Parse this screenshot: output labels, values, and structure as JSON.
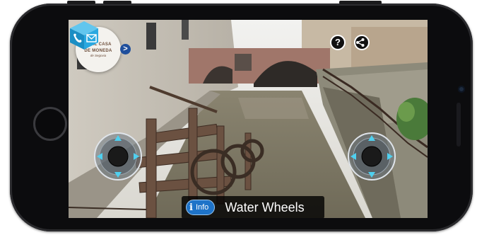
{
  "app": {
    "logo": {
      "line1": "REAL CASA",
      "line2": "DE MONEDA",
      "line3": "de Segovia"
    },
    "nav_chevron": ">",
    "top_buttons": {
      "help": "?",
      "share_icon": "share-icon",
      "cube_icon": "phone-envelope-cube-icon"
    },
    "joysticks": {
      "left": {
        "name": "left-joystick"
      },
      "right": {
        "name": "right-joystick"
      }
    },
    "caption": {
      "info_icon": "i",
      "info_label": "Info",
      "title": "Water Wheels"
    }
  },
  "colors": {
    "accent_blue": "#1e73c8",
    "cube_blue": "#2aa8e0",
    "joystick_arrow": "#4fd0ef",
    "caption_bg": "#000000"
  }
}
